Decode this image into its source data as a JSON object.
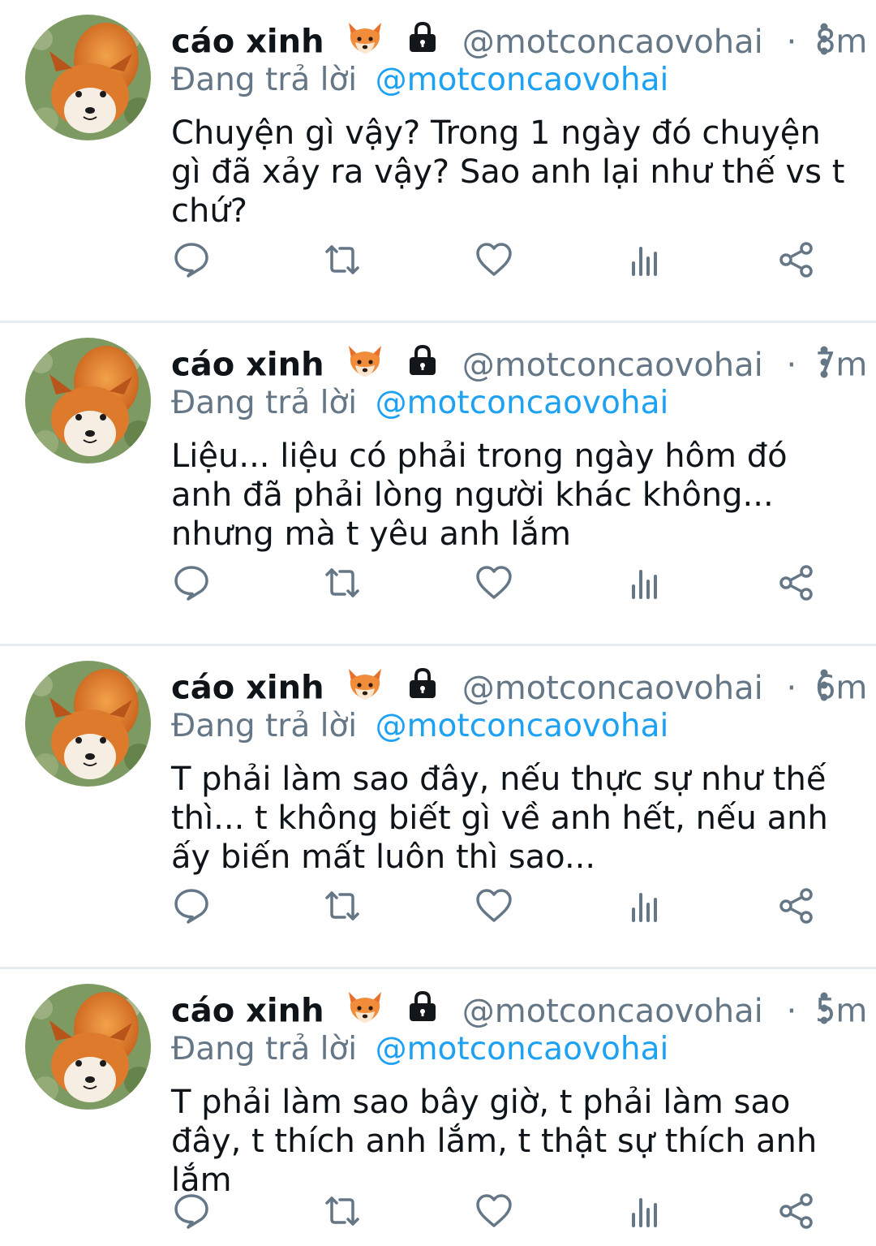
{
  "tweets": [
    {
      "name": "cáo xinh",
      "handle": "@motconcaovohai",
      "separator": "·",
      "time": "8m",
      "replying_label": "Đang trả lời",
      "replying_to": "@motconcaovohai",
      "text": "Chuyện gì vậy? Trong 1 ngày đó chuyện gì đã xảy ra vậy? Sao anh lại như thế vs t chứ?"
    },
    {
      "name": "cáo xinh",
      "handle": "@motconcaovohai",
      "separator": "·",
      "time": "7m",
      "replying_label": "Đang trả lời",
      "replying_to": "@motconcaovohai",
      "text": "Liệu... liệu có phải trong ngày hôm đó anh đã phải lòng người khác không... nhưng mà t yêu anh lắm"
    },
    {
      "name": "cáo xinh",
      "handle": "@motconcaovohai",
      "separator": "·",
      "time": "6m",
      "replying_label": "Đang trả lời",
      "replying_to": "@motconcaovohai",
      "text": "T phải làm sao đây, nếu thực sự như thế thì... t không biết gì về anh hết, nếu anh ấy biến mất luôn thì sao..."
    },
    {
      "name": "cáo xinh",
      "handle": "@motconcaovohai",
      "separator": "·",
      "time": "5m",
      "replying_label": "Đang trả lời",
      "replying_to": "@motconcaovohai",
      "text": "T phải làm sao bây giờ, t phải làm sao đây, t thích anh lắm, t thật sự thích anh lắm"
    }
  ],
  "icons": {
    "name_badges": [
      "fox-emoji",
      "lock-icon"
    ],
    "overflow": "more-vertical-icon",
    "actions": [
      "reply-icon",
      "retweet-icon",
      "like-icon",
      "analytics-icon",
      "share-icon"
    ]
  },
  "colors": {
    "text": "#0f1419",
    "secondary": "#657786",
    "mention": "#1da1f2",
    "divider": "#e6ecf0"
  }
}
